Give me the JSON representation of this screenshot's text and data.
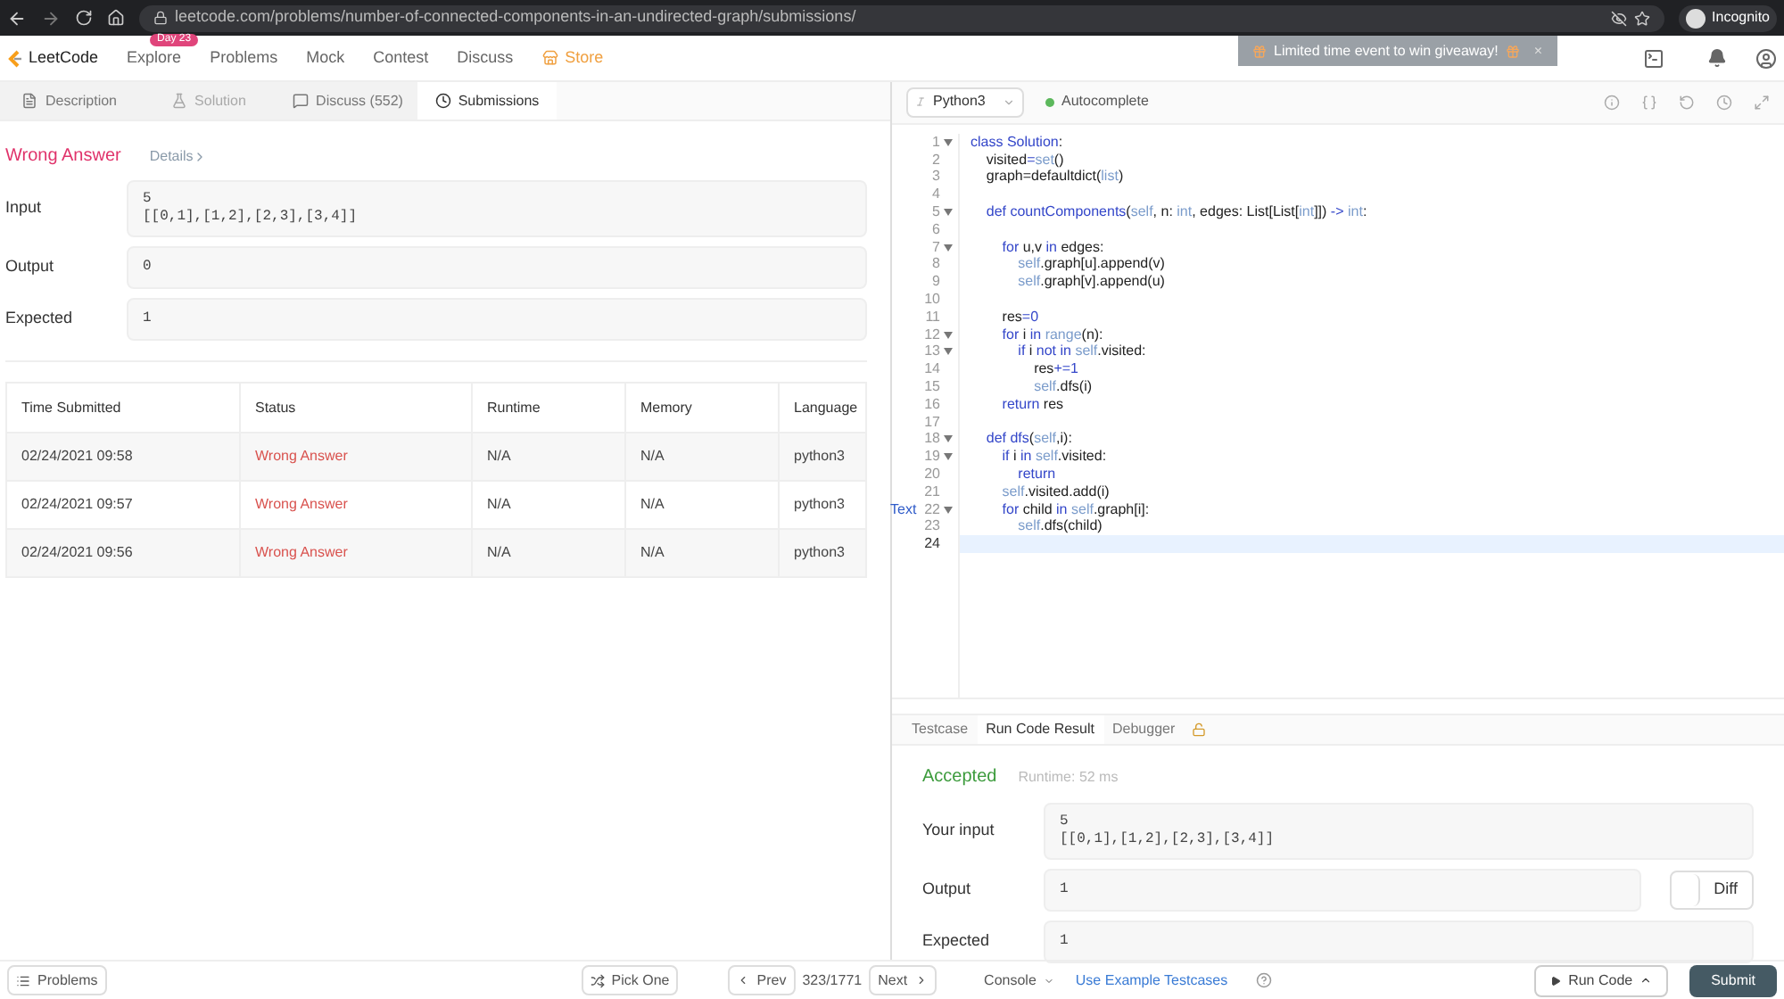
{
  "browser": {
    "url": "leetcode.com/problems/number-of-connected-components-in-an-undirected-graph/submissions/",
    "profile": "Incognito"
  },
  "nav": {
    "logo": "LeetCode",
    "items": [
      {
        "label": "Explore",
        "badge": "Day 23",
        "kind": "plain"
      },
      {
        "label": "Problems",
        "kind": "plain"
      },
      {
        "label": "Mock",
        "kind": "plain"
      },
      {
        "label": "Contest",
        "kind": "plain"
      },
      {
        "label": "Discuss",
        "kind": "plain"
      },
      {
        "label": "Store",
        "kind": "store"
      }
    ],
    "banner": "Limited time event to win giveaway!",
    "banner_close": "×"
  },
  "left_tabs": [
    {
      "label": "Description",
      "selected": false,
      "disabled": false,
      "kind": "description"
    },
    {
      "label": "Solution",
      "selected": false,
      "disabled": true,
      "kind": "solution"
    },
    {
      "label": "Discuss (552)",
      "selected": false,
      "disabled": false,
      "kind": "discuss"
    },
    {
      "label": "Submissions",
      "selected": true,
      "disabled": false,
      "kind": "submissions"
    }
  ],
  "result": {
    "status": "Wrong Answer",
    "details": "Details",
    "fields": [
      {
        "label": "Input",
        "lines": [
          "5",
          "[[0,1],[1,2],[2,3],[3,4]]"
        ]
      },
      {
        "label": "Output",
        "lines": [
          "0"
        ]
      },
      {
        "label": "Expected",
        "lines": [
          "1"
        ]
      }
    ]
  },
  "table": {
    "columns": [
      "Time Submitted",
      "Status",
      "Runtime",
      "Memory",
      "Language"
    ],
    "rows": [
      [
        "02/24/2021 09:58",
        "Wrong Answer",
        "N/A",
        "N/A",
        "python3"
      ],
      [
        "02/24/2021 09:57",
        "Wrong Answer",
        "N/A",
        "N/A",
        "python3"
      ],
      [
        "02/24/2021 09:56",
        "Wrong Answer",
        "N/A",
        "N/A",
        "python3"
      ]
    ]
  },
  "editor": {
    "language": "Python3",
    "autocomplete": {
      "label": "Autocomplete",
      "on": true
    },
    "lines": [
      {
        "number": "1",
        "fold": true,
        "current": false,
        "segments": [
          {
            "text": "class Solution",
            "kind": "keyword"
          },
          {
            "text": ":",
            "kind": "plain"
          }
        ]
      },
      {
        "number": "2",
        "fold": false,
        "current": false,
        "segments": [
          {
            "text": "    visited",
            "kind": "plain"
          },
          {
            "text": "=",
            "kind": "keyword"
          },
          {
            "text": "set",
            "kind": "builtin"
          },
          {
            "text": "()",
            "kind": "plain"
          }
        ]
      },
      {
        "number": "3",
        "fold": false,
        "current": false,
        "segments": [
          {
            "text": "    graph=defaultdict(",
            "kind": "plain"
          },
          {
            "text": "list",
            "kind": "builtin"
          },
          {
            "text": ")",
            "kind": "plain"
          }
        ]
      },
      {
        "number": "4",
        "fold": false,
        "current": false
      },
      {
        "number": "5",
        "fold": true,
        "current": false,
        "segments": [
          {
            "text": "    def countComponents",
            "kind": "keyword"
          },
          {
            "text": "(",
            "kind": "plain"
          },
          {
            "text": "self",
            "kind": "builtin"
          },
          {
            "text": ", n: ",
            "kind": "plain"
          },
          {
            "text": "int",
            "kind": "builtin"
          },
          {
            "text": ", edges: List[List[",
            "kind": "plain"
          },
          {
            "text": "int",
            "kind": "builtin"
          },
          {
            "text": "]]) ",
            "kind": "plain"
          },
          {
            "text": "->",
            "kind": "keyword"
          },
          {
            "text": " int",
            "kind": "builtin"
          },
          {
            "text": ":",
            "kind": "plain"
          }
        ]
      },
      {
        "number": "6",
        "fold": false,
        "current": false
      },
      {
        "number": "7",
        "fold": true,
        "current": false,
        "segments": [
          {
            "text": "        for",
            "kind": "keyword"
          },
          {
            "text": " u,v ",
            "kind": "plain"
          },
          {
            "text": "in",
            "kind": "keyword"
          },
          {
            "text": " edges:",
            "kind": "plain"
          }
        ]
      },
      {
        "number": "8",
        "fold": false,
        "current": false,
        "segments": [
          {
            "text": "            self",
            "kind": "builtin"
          },
          {
            "text": ".graph[u].append(v)",
            "kind": "plain"
          }
        ]
      },
      {
        "number": "9",
        "fold": false,
        "current": false,
        "segments": [
          {
            "text": "            self",
            "kind": "builtin"
          },
          {
            "text": ".graph[v].append(u)",
            "kind": "plain"
          }
        ]
      },
      {
        "number": "10",
        "fold": false,
        "current": false
      },
      {
        "number": "11",
        "fold": false,
        "current": false,
        "segments": [
          {
            "text": "        res",
            "kind": "plain"
          },
          {
            "text": "=0",
            "kind": "keyword"
          }
        ]
      },
      {
        "number": "12",
        "fold": true,
        "current": false,
        "segments": [
          {
            "text": "        for",
            "kind": "keyword"
          },
          {
            "text": " i ",
            "kind": "plain"
          },
          {
            "text": "in",
            "kind": "keyword"
          },
          {
            "text": " range",
            "kind": "builtin"
          },
          {
            "text": "(n):",
            "kind": "plain"
          }
        ]
      },
      {
        "number": "13",
        "fold": true,
        "current": false,
        "segments": [
          {
            "text": "            if",
            "kind": "keyword"
          },
          {
            "text": " i ",
            "kind": "plain"
          },
          {
            "text": "not in",
            "kind": "keyword"
          },
          {
            "text": " self",
            "kind": "builtin"
          },
          {
            "text": ".visited:",
            "kind": "plain"
          }
        ]
      },
      {
        "number": "14",
        "fold": false,
        "current": false,
        "segments": [
          {
            "text": "                res",
            "kind": "plain"
          },
          {
            "text": "+=1",
            "kind": "keyword"
          }
        ]
      },
      {
        "number": "15",
        "fold": false,
        "current": false,
        "segments": [
          {
            "text": "                self",
            "kind": "builtin"
          },
          {
            "text": ".dfs(i)",
            "kind": "plain"
          }
        ]
      },
      {
        "number": "16",
        "fold": false,
        "current": false,
        "segments": [
          {
            "text": "        return",
            "kind": "keyword"
          },
          {
            "text": " res",
            "kind": "plain"
          }
        ]
      },
      {
        "number": "17",
        "fold": false,
        "current": false
      },
      {
        "number": "18",
        "fold": true,
        "current": false,
        "segments": [
          {
            "text": "    def dfs",
            "kind": "keyword"
          },
          {
            "text": "(",
            "kind": "plain"
          },
          {
            "text": "self",
            "kind": "builtin"
          },
          {
            "text": ",i):",
            "kind": "plain"
          }
        ]
      },
      {
        "number": "19",
        "fold": true,
        "current": false,
        "segments": [
          {
            "text": "        if",
            "kind": "keyword"
          },
          {
            "text": " i ",
            "kind": "plain"
          },
          {
            "text": "in",
            "kind": "keyword"
          },
          {
            "text": " self",
            "kind": "builtin"
          },
          {
            "text": ".visited:",
            "kind": "plain"
          }
        ]
      },
      {
        "number": "20",
        "fold": false,
        "current": false,
        "segments": [
          {
            "text": "            return",
            "kind": "keyword"
          }
        ]
      },
      {
        "number": "21",
        "fold": false,
        "current": false,
        "segments": [
          {
            "text": "        self",
            "kind": "builtin"
          },
          {
            "text": ".visited.add(i)",
            "kind": "plain"
          }
        ]
      },
      {
        "number": "22",
        "fold": true,
        "current": false,
        "gutter_label": "Text",
        "segments": [
          {
            "text": "        for",
            "kind": "keyword"
          },
          {
            "text": " child ",
            "kind": "plain"
          },
          {
            "text": "in",
            "kind": "keyword"
          },
          {
            "text": " self",
            "kind": "builtin"
          },
          {
            "text": ".graph[i]:",
            "kind": "plain"
          }
        ]
      },
      {
        "number": "23",
        "fold": false,
        "current": false,
        "segments": [
          {
            "text": "            self",
            "kind": "builtin"
          },
          {
            "text": ".dfs(child)",
            "kind": "plain"
          }
        ]
      },
      {
        "number": "24",
        "fold": false,
        "current": true
      }
    ]
  },
  "console_tabs": [
    {
      "label": "Testcase",
      "selected": false,
      "locked": false
    },
    {
      "label": "Run Code Result",
      "selected": true,
      "locked": false
    },
    {
      "label": "Debugger",
      "selected": false,
      "locked": true
    }
  ],
  "run_result": {
    "status": "Accepted",
    "runtime": "Runtime: 52 ms",
    "fields": [
      {
        "label": "Your input",
        "lines": [
          "5",
          "[[0,1],[1,2],[2,3],[3,4]]"
        ]
      },
      {
        "label": "Output",
        "lines": [
          "1"
        ],
        "diff": {
          "label": "Diff",
          "on": false
        }
      },
      {
        "label": "Expected",
        "lines": [
          "1"
        ]
      }
    ]
  },
  "footer": {
    "problems": "Problems",
    "pick_one": "Pick One",
    "prev": "Prev",
    "counter": "323/1771",
    "next": "Next",
    "console": "Console",
    "example": "Use Example Testcases",
    "run": "Run Code",
    "submit": "Submit"
  }
}
